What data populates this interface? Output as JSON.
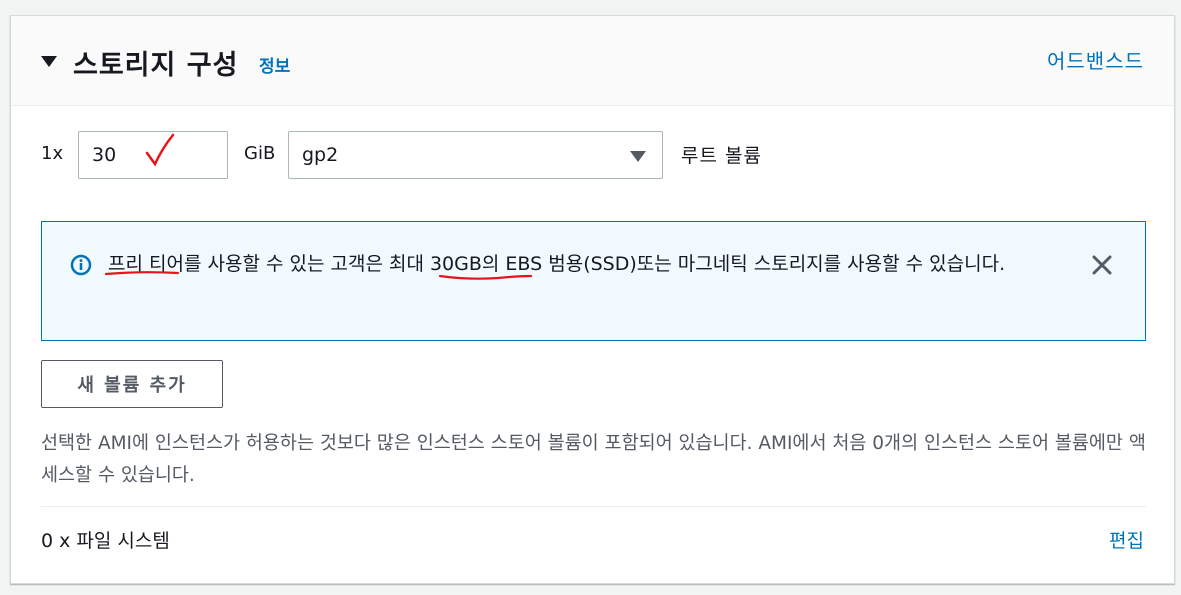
{
  "section": {
    "title": "스토리지 구성",
    "info_link": "정보",
    "advanced_link": "어드밴스드"
  },
  "volume": {
    "multiplier": "1x",
    "size_value": "30",
    "unit": "GiB",
    "type_value": "gp2",
    "label": "루트 볼륨"
  },
  "alert": {
    "text_part1": "프리 티",
    "text_part2": "어를 사용할 수 있는 고객은 ",
    "text_part3": "최대 30GB",
    "text_part4": "의 EBS 범용(SSD)또는 마그네틱 스토리지를 사용할 수 있습니다."
  },
  "add_volume_button": "새 볼륨 추가",
  "note": "선택한 AMI에 인스턴스가 허용하는 것보다 많은 인스턴스 스토어 볼륨이 포함되어 있습니다. AMI에서 처음 0개의 인스턴스 스토어 볼륨에만 액세스할 수 있습니다.",
  "file_system": {
    "label": "0 x 파일 시스템",
    "edit_link": "편집"
  },
  "colors": {
    "link": "#0073bb",
    "alert_bg": "#f1faff",
    "alert_border": "#0073bb",
    "annotation": "#e8141a"
  },
  "icons": {
    "caret": "caret-down-icon",
    "info": "info-icon",
    "close": "close-icon",
    "annotation": "red-checkmark-annotation"
  }
}
